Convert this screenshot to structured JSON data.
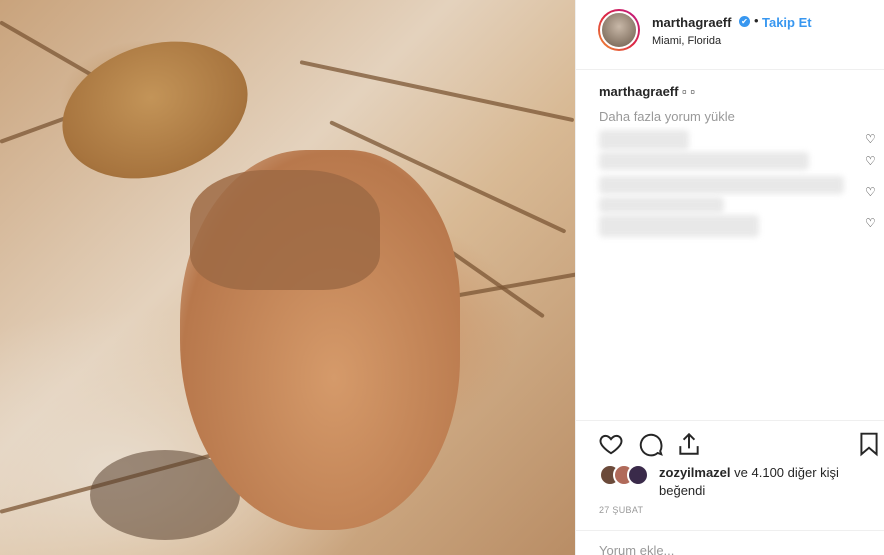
{
  "post": {
    "username": "marthagraeff",
    "verified_mark": "✔",
    "separator": "•",
    "follow_label": "Takip Et",
    "location": "Miami, Florida"
  },
  "caption": {
    "username": "marthagraeff",
    "text": "▫ ▫"
  },
  "comments": {
    "load_more_label": "Daha fazla yorum yükle"
  },
  "likes": {
    "name": "zozyilmazel",
    "text": "ve 4.100 diğer kişi beğendi"
  },
  "date": "27 ŞUBAT",
  "comment_placeholder": "Yorum ekle...",
  "colors": {
    "accent": "#3897f0",
    "text": "#262626",
    "muted": "#999999",
    "border": "#efefef"
  },
  "icons": [
    "heart-icon",
    "comment-icon",
    "share-icon",
    "bookmark-icon",
    "verified-icon"
  ]
}
